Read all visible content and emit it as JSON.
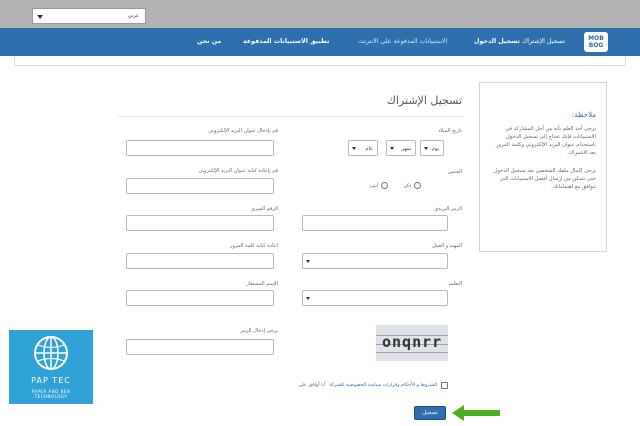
{
  "language_select": {
    "value": "عربي"
  },
  "navbar": {
    "logo_line1": "MOB",
    "logo_line2": "BOG",
    "links": [
      "تسجيل الإشتراك",
      "تسجيل الدخول",
      "الاستبيانات المدفوعة على الانترنت",
      "تطبيق الاستبيانات المدفوعة",
      "من نحن"
    ]
  },
  "note": {
    "title": "ملاحظة:",
    "paragraph1": "يرجى أخذ العلم بأنه من أجل المشاركة في الاستبيانات فإنك تحتاج إلى تسجيل الدخول باستخدام عنوان البريد الإلكتروني وكلمة المرور بعد الاشتراك.",
    "paragraph2": "يرجى إكمال ملفك الشخصي بعد تسجيل الدخول حتى نتمكن من إرسال أفضل الاستبيانات التي تتوافق مع اهتماماتك."
  },
  "form": {
    "title": "تسجيل الإشتراك",
    "birthdate_label": "تاريخ الميلاد",
    "day_value": "يوم",
    "month_value": "شهر",
    "year_value": "عام",
    "gender_label": "الجنس",
    "male_label": "ذكر",
    "female_label": "أنثى",
    "postal_label": "الرمز البريدي",
    "occupation_label": "المهنة و العمل",
    "education_label": "التعليم",
    "email_label": "قم بإدخال عنوان البريد الإلكتروني",
    "email_confirm_label": "قم بإعادة كتابة عنوان البريد الإلكتروني",
    "password_label": "الرقم السري",
    "password_confirm_label": "اعادة كتابة كلمة المرور",
    "username_label": "الإسم المستعار",
    "captcha_label": "يرجى إدخال الرمز",
    "captcha_text": "onqnrr",
    "terms_link": "الشروط و الأحكام وقرارات سياسة الخصوصية للشركة",
    "terms_suffix": "أنا أوافق على",
    "submit_label": "تسجيل"
  },
  "watermark": {
    "name": "PAP TEC",
    "sub_line1": "PAPER AND BEN",
    "sub_line2": "TECHNOLOGY"
  },
  "colors": {
    "nav": "#2f6fae",
    "accent_arrow": "#4caf1c",
    "watermark": "#30a2d8"
  }
}
